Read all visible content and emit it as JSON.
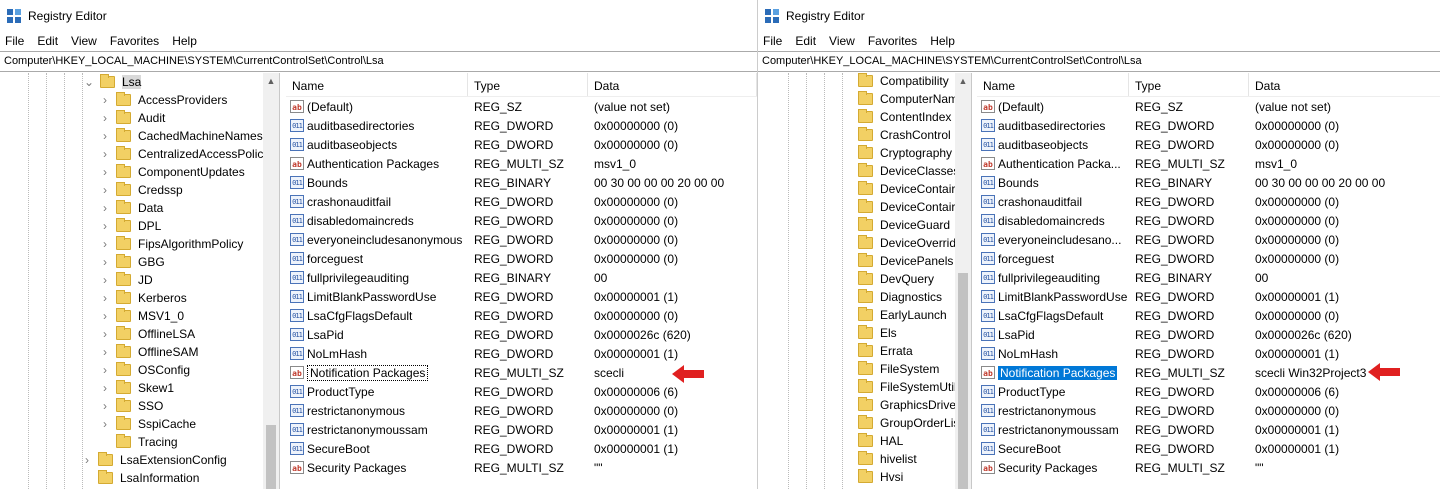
{
  "left": {
    "title": "Registry Editor",
    "menu": [
      "File",
      "Edit",
      "View",
      "Favorites",
      "Help"
    ],
    "address": "Computer\\HKEY_LOCAL_MACHINE\\SYSTEM\\CurrentControlSet\\Control\\Lsa",
    "tree_selected": "Lsa",
    "tree": [
      "AccessProviders",
      "Audit",
      "CachedMachineNames",
      "CentralizedAccessPolici",
      "ComponentUpdates",
      "Credssp",
      "Data",
      "DPL",
      "FipsAlgorithmPolicy",
      "GBG",
      "JD",
      "Kerberos",
      "MSV1_0",
      "OfflineLSA",
      "OfflineSAM",
      "OSConfig",
      "Skew1",
      "SSO",
      "SspiCache",
      "Tracing"
    ],
    "tree_tail": [
      "LsaExtensionConfig",
      "LsaInformation"
    ],
    "columns": {
      "name": "Name",
      "type": "Type",
      "data": "Data"
    },
    "values": [
      {
        "name": "(Default)",
        "type": "REG_SZ",
        "data": "(value not set)",
        "icon": "string-value-icon"
      },
      {
        "name": "auditbasedirectories",
        "type": "REG_DWORD",
        "data": "0x00000000 (0)",
        "icon": "binary-value-icon"
      },
      {
        "name": "auditbaseobjects",
        "type": "REG_DWORD",
        "data": "0x00000000 (0)",
        "icon": "binary-value-icon"
      },
      {
        "name": "Authentication Packages",
        "type": "REG_MULTI_SZ",
        "data": "msv1_0",
        "icon": "string-value-icon"
      },
      {
        "name": "Bounds",
        "type": "REG_BINARY",
        "data": "00 30 00 00 00 20 00 00",
        "icon": "binary-value-icon"
      },
      {
        "name": "crashonauditfail",
        "type": "REG_DWORD",
        "data": "0x00000000 (0)",
        "icon": "binary-value-icon"
      },
      {
        "name": "disabledomaincreds",
        "type": "REG_DWORD",
        "data": "0x00000000 (0)",
        "icon": "binary-value-icon"
      },
      {
        "name": "everyoneincludesanonymous",
        "type": "REG_DWORD",
        "data": "0x00000000 (0)",
        "icon": "binary-value-icon"
      },
      {
        "name": "forceguest",
        "type": "REG_DWORD",
        "data": "0x00000000 (0)",
        "icon": "binary-value-icon"
      },
      {
        "name": "fullprivilegeauditing",
        "type": "REG_BINARY",
        "data": "00",
        "icon": "binary-value-icon"
      },
      {
        "name": "LimitBlankPasswordUse",
        "type": "REG_DWORD",
        "data": "0x00000001 (1)",
        "icon": "binary-value-icon"
      },
      {
        "name": "LsaCfgFlagsDefault",
        "type": "REG_DWORD",
        "data": "0x00000000 (0)",
        "icon": "binary-value-icon"
      },
      {
        "name": "LsaPid",
        "type": "REG_DWORD",
        "data": "0x0000026c (620)",
        "icon": "binary-value-icon"
      },
      {
        "name": "NoLmHash",
        "type": "REG_DWORD",
        "data": "0x00000001 (1)",
        "icon": "binary-value-icon"
      },
      {
        "name": "Notification Packages",
        "type": "REG_MULTI_SZ",
        "data": "scecli",
        "icon": "string-value-icon"
      },
      {
        "name": "ProductType",
        "type": "REG_DWORD",
        "data": "0x00000006 (6)",
        "icon": "binary-value-icon"
      },
      {
        "name": "restrictanonymous",
        "type": "REG_DWORD",
        "data": "0x00000000 (0)",
        "icon": "binary-value-icon"
      },
      {
        "name": "restrictanonymoussam",
        "type": "REG_DWORD",
        "data": "0x00000001 (1)",
        "icon": "binary-value-icon"
      },
      {
        "name": "SecureBoot",
        "type": "REG_DWORD",
        "data": "0x00000001 (1)",
        "icon": "binary-value-icon"
      },
      {
        "name": "Security Packages",
        "type": "REG_MULTI_SZ",
        "data": "\"\"",
        "icon": "string-value-icon"
      }
    ]
  },
  "right": {
    "title": "Registry Editor",
    "menu": [
      "File",
      "Edit",
      "View",
      "Favorites",
      "Help"
    ],
    "address": "Computer\\HKEY_LOCAL_MACHINE\\SYSTEM\\CurrentControlSet\\Control\\Lsa",
    "tree": [
      "Compatibility",
      "ComputerNam",
      "ContentIndex",
      "CrashControl",
      "Cryptography",
      "DeviceClasses",
      "DeviceContair",
      "DeviceContair",
      "DeviceGuard",
      "DeviceOverrid",
      "DevicePanels",
      "DevQuery",
      "Diagnostics",
      "EarlyLaunch",
      "Els",
      "Errata",
      "FileSystem",
      "FileSystemUtil",
      "GraphicsDriver",
      "GroupOrderLis",
      "HAL",
      "hivelist",
      "Hvsi"
    ],
    "columns": {
      "name": "Name",
      "type": "Type",
      "data": "Data"
    },
    "values": [
      {
        "name": "(Default)",
        "type": "REG_SZ",
        "data": "(value not set)",
        "icon": "string-value-icon"
      },
      {
        "name": "auditbasedirectories",
        "type": "REG_DWORD",
        "data": "0x00000000 (0)",
        "icon": "binary-value-icon"
      },
      {
        "name": "auditbaseobjects",
        "type": "REG_DWORD",
        "data": "0x00000000 (0)",
        "icon": "binary-value-icon"
      },
      {
        "name": "Authentication Packa...",
        "type": "REG_MULTI_SZ",
        "data": "msv1_0",
        "icon": "string-value-icon"
      },
      {
        "name": "Bounds",
        "type": "REG_BINARY",
        "data": "00 30 00 00 00 20 00 00",
        "icon": "binary-value-icon"
      },
      {
        "name": "crashonauditfail",
        "type": "REG_DWORD",
        "data": "0x00000000 (0)",
        "icon": "binary-value-icon"
      },
      {
        "name": "disabledomaincreds",
        "type": "REG_DWORD",
        "data": "0x00000000 (0)",
        "icon": "binary-value-icon"
      },
      {
        "name": "everyoneincludesano...",
        "type": "REG_DWORD",
        "data": "0x00000000 (0)",
        "icon": "binary-value-icon"
      },
      {
        "name": "forceguest",
        "type": "REG_DWORD",
        "data": "0x00000000 (0)",
        "icon": "binary-value-icon"
      },
      {
        "name": "fullprivilegeauditing",
        "type": "REG_BINARY",
        "data": "00",
        "icon": "binary-value-icon"
      },
      {
        "name": "LimitBlankPasswordUse",
        "type": "REG_DWORD",
        "data": "0x00000001 (1)",
        "icon": "binary-value-icon"
      },
      {
        "name": "LsaCfgFlagsDefault",
        "type": "REG_DWORD",
        "data": "0x00000000 (0)",
        "icon": "binary-value-icon"
      },
      {
        "name": "LsaPid",
        "type": "REG_DWORD",
        "data": "0x0000026c (620)",
        "icon": "binary-value-icon"
      },
      {
        "name": "NoLmHash",
        "type": "REG_DWORD",
        "data": "0x00000001 (1)",
        "icon": "binary-value-icon"
      },
      {
        "name": "Notification Packages",
        "type": "REG_MULTI_SZ",
        "data": "scecli",
        "data_extra": "Win32Project3",
        "icon": "string-value-icon"
      },
      {
        "name": "ProductType",
        "type": "REG_DWORD",
        "data": "0x00000006 (6)",
        "icon": "binary-value-icon"
      },
      {
        "name": "restrictanonymous",
        "type": "REG_DWORD",
        "data": "0x00000000 (0)",
        "icon": "binary-value-icon"
      },
      {
        "name": "restrictanonymoussam",
        "type": "REG_DWORD",
        "data": "0x00000001 (1)",
        "icon": "binary-value-icon"
      },
      {
        "name": "SecureBoot",
        "type": "REG_DWORD",
        "data": "0x00000001 (1)",
        "icon": "binary-value-icon"
      },
      {
        "name": "Security Packages",
        "type": "REG_MULTI_SZ",
        "data": "\"\"",
        "icon": "string-value-icon"
      }
    ]
  },
  "colors": {
    "selection": "#0078d7",
    "annotation": "#e02020",
    "folder": "#f2d064"
  }
}
